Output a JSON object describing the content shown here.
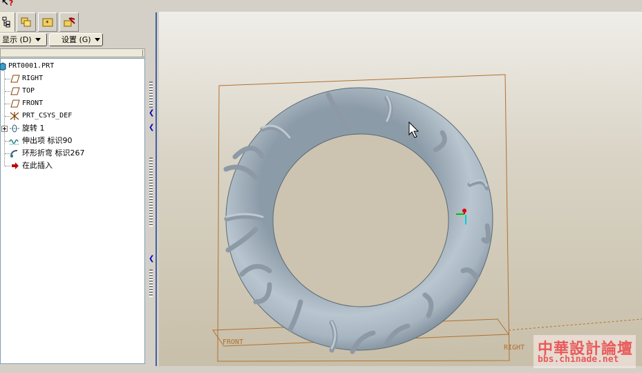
{
  "toolbar": {
    "display_label": "显示 (D)",
    "settings_label": "设置 (G)"
  },
  "tabs": [
    {
      "name": "model-tree",
      "icon": "model-tree-icon",
      "active": true
    },
    {
      "name": "folder-browser",
      "icon": "folder-browser-icon",
      "active": false
    },
    {
      "name": "favorites",
      "icon": "favorites-icon",
      "active": false
    },
    {
      "name": "connections",
      "icon": "connections-icon",
      "active": false
    }
  ],
  "tree": {
    "root": "PRT0001.PRT",
    "items": [
      {
        "label": "RIGHT",
        "icon": "datum-plane-icon"
      },
      {
        "label": "TOP",
        "icon": "datum-plane-icon"
      },
      {
        "label": "FRONT",
        "icon": "datum-plane-icon"
      },
      {
        "label": "PRT_CSYS_DEF",
        "icon": "csys-icon"
      },
      {
        "label": "旋转 1",
        "icon": "revolve-icon",
        "expandable": true
      },
      {
        "label": "伸出项 标识90",
        "icon": "protrusion-icon"
      },
      {
        "label": "环形折弯 标识267",
        "icon": "toroidal-bend-icon"
      },
      {
        "label": "在此插入",
        "icon": "insert-here-arrow-icon"
      }
    ]
  },
  "viewport": {
    "plane_labels": {
      "front": "FRONT",
      "right": "RIGHT"
    }
  },
  "watermark": {
    "title": "中華設計論壇",
    "url": "bbs.chinade.net"
  },
  "colors": {
    "model": "#9fb0bf",
    "datum_plane": "#b07030",
    "watermark": "#e85a5a"
  }
}
